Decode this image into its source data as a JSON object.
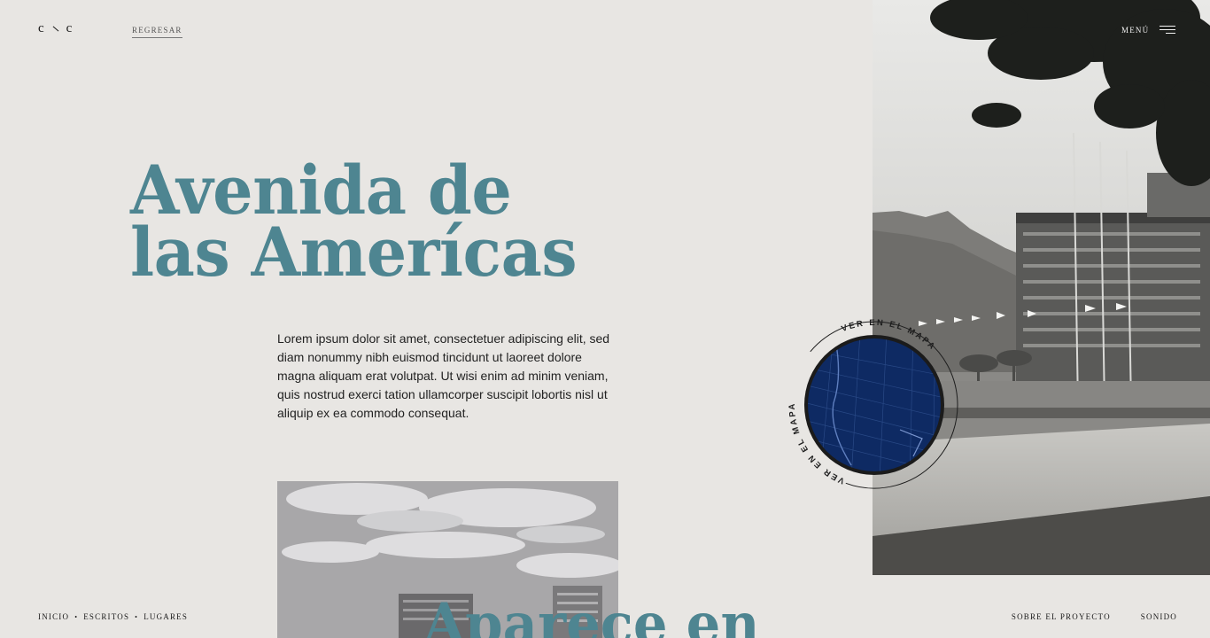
{
  "header": {
    "logo_left": "c",
    "logo_right": "c",
    "back_label": "REGRESAR",
    "menu_label": "MENÚ"
  },
  "hero": {
    "title_line1": "Avenida de",
    "title_line2": "las Ameríca",
    "intro": "Lorem ipsum dolor sit amet, consectetuer adipiscing elit, sed diam nonummy nibh euismod tincidunt ut laoreet dolore magna aliquam erat volutpat. Ut wisi enim ad minim veniam, quis nostrud exerci tation ullamcorper suscipit lobortis nisl ut aliquip ex ea commodo consequat."
  },
  "map_badge": {
    "label": "VER EN EL MAPA"
  },
  "next_section": {
    "title": "Aparece en"
  },
  "footer": {
    "nav": [
      "INICIO",
      "ESCRITOS",
      "LUGARES"
    ],
    "separator": "•",
    "about": "SOBRE EL PROYECTO",
    "sound": "SONIDO"
  },
  "colors": {
    "background": "#e8e6e3",
    "accent_teal": "#4e8591",
    "map_blue": "#0e2a63"
  },
  "icons": [
    "menu-icon",
    "map-thumbnail"
  ]
}
